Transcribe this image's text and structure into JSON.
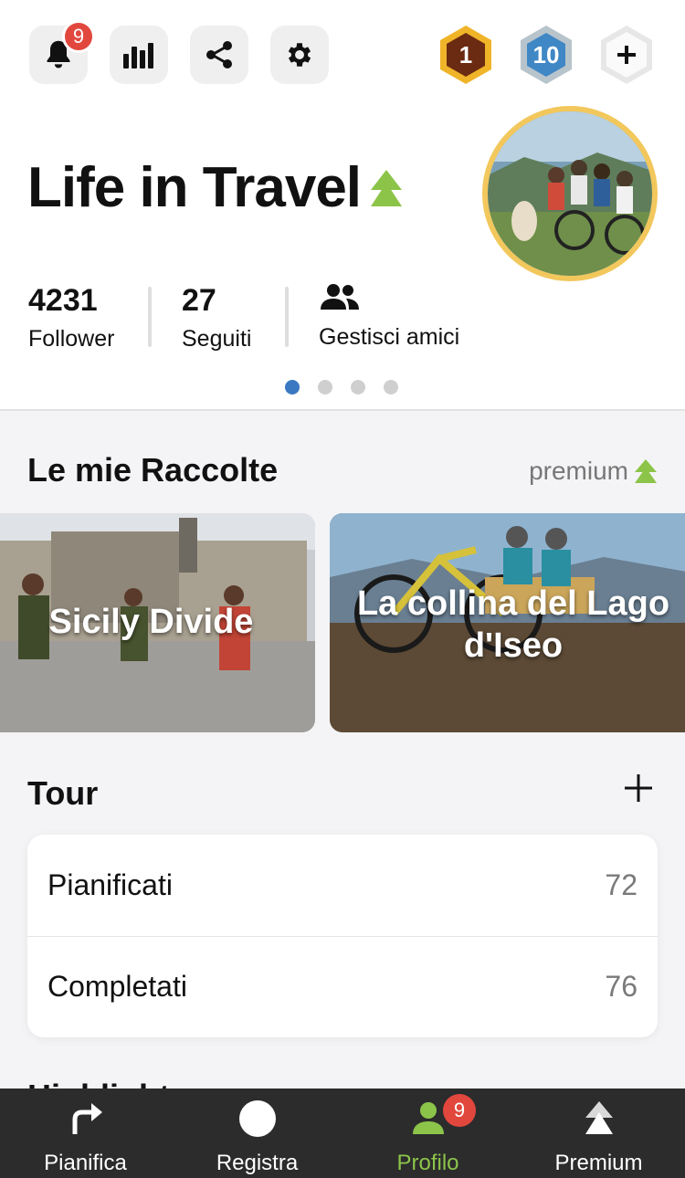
{
  "header": {
    "notifications_count": "9",
    "badges": [
      {
        "value": "1",
        "color": "#e8a020"
      },
      {
        "value": "10",
        "color": "#3f87c5"
      }
    ]
  },
  "profile": {
    "name": "Life in Travel",
    "stats": [
      {
        "value": "4231",
        "label": "Follower"
      },
      {
        "value": "27",
        "label": "Seguiti"
      },
      {
        "label": "Gestisci amici"
      }
    ],
    "pages": 4,
    "active_page": 1
  },
  "collections": {
    "title": "Le mie Raccolte",
    "premium_label": "premium",
    "items": [
      {
        "title": "Sicily Divide"
      },
      {
        "title": "La collina del Lago d'Iseo"
      }
    ]
  },
  "tour": {
    "title": "Tour",
    "rows": [
      {
        "label": "Pianificati",
        "value": "72"
      },
      {
        "label": "Completati",
        "value": "76"
      }
    ]
  },
  "next_section_peek": "Highlights",
  "tabbar": {
    "items": [
      {
        "label": "Pianifica",
        "icon": "route-arrow-icon"
      },
      {
        "label": "Registra",
        "icon": "record-circle-icon"
      },
      {
        "label": "Profilo",
        "icon": "person-icon",
        "badge": "9",
        "active": true
      },
      {
        "label": "Premium",
        "icon": "premium-tree-icon"
      }
    ]
  },
  "colors": {
    "accent_green": "#8cc44a",
    "badge_red": "#e2473d",
    "active_dot": "#3a78c2",
    "avatar_ring": "#f2c75c"
  }
}
